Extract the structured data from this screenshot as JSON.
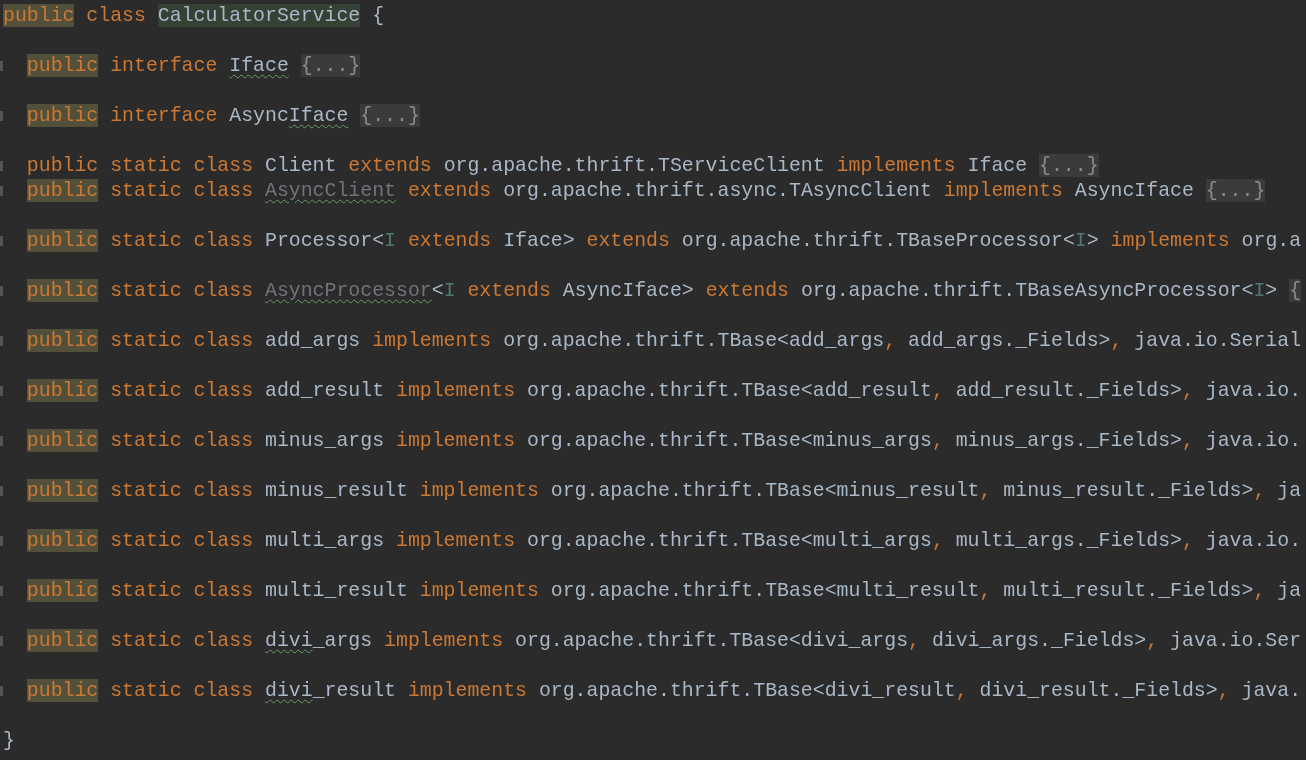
{
  "editor": {
    "lines": [
      {
        "kind": "code",
        "indented": false,
        "fold_marker": false,
        "tokens": [
          {
            "text": "public",
            "kind": "keyword-marked"
          },
          {
            "text": " class ",
            "kind": "keyword"
          },
          {
            "text": "CalculatorService",
            "kind": "name-marked"
          },
          {
            "text": " {",
            "kind": "name"
          }
        ]
      },
      {
        "kind": "blank"
      },
      {
        "kind": "code",
        "indented": true,
        "fold_marker": true,
        "tokens": [
          {
            "text": "public",
            "kind": "keyword-marked"
          },
          {
            "text": " interface ",
            "kind": "keyword"
          },
          {
            "text": "Iface",
            "kind": "name-typo"
          },
          {
            "text": "{...}",
            "kind": "fold"
          }
        ]
      },
      {
        "kind": "blank"
      },
      {
        "kind": "code",
        "indented": true,
        "fold_marker": true,
        "tokens": [
          {
            "text": "public",
            "kind": "keyword-marked"
          },
          {
            "text": " interface ",
            "kind": "keyword"
          },
          {
            "text": "Async",
            "kind": "name"
          },
          {
            "text": "Iface",
            "kind": "name-typo"
          },
          {
            "text": "{...}",
            "kind": "fold"
          }
        ]
      },
      {
        "kind": "blank"
      },
      {
        "kind": "code",
        "indented": true,
        "fold_marker": true,
        "tokens": [
          {
            "text": "public static class ",
            "kind": "keyword"
          },
          {
            "text": "Client",
            "kind": "name"
          },
          {
            "text": " extends ",
            "kind": "keyword"
          },
          {
            "text": "org.apache.thrift.TServiceClient",
            "kind": "name"
          },
          {
            "text": " implements ",
            "kind": "keyword"
          },
          {
            "text": "Iface",
            "kind": "name"
          },
          {
            "text": "{...}",
            "kind": "fold"
          }
        ]
      },
      {
        "kind": "code",
        "indented": true,
        "fold_marker": true,
        "tokens": [
          {
            "text": "public",
            "kind": "keyword-marked"
          },
          {
            "text": " static class ",
            "kind": "keyword"
          },
          {
            "text": "AsyncClient",
            "kind": "unused-typo"
          },
          {
            "text": " extends ",
            "kind": "keyword"
          },
          {
            "text": "org.apache.thrift.async.TAsyncClient",
            "kind": "name"
          },
          {
            "text": " implements ",
            "kind": "keyword"
          },
          {
            "text": "AsyncIface",
            "kind": "name"
          },
          {
            "text": "{...}",
            "kind": "fold"
          }
        ]
      },
      {
        "kind": "blank"
      },
      {
        "kind": "code",
        "indented": true,
        "fold_marker": true,
        "tokens": [
          {
            "text": "public",
            "kind": "keyword-marked"
          },
          {
            "text": " static class ",
            "kind": "keyword"
          },
          {
            "text": "Processor<",
            "kind": "name"
          },
          {
            "text": "I",
            "kind": "param"
          },
          {
            "text": " extends ",
            "kind": "keyword"
          },
          {
            "text": "Iface>",
            "kind": "name"
          },
          {
            "text": " extends ",
            "kind": "keyword"
          },
          {
            "text": "org.apache.thrift.TBaseProcessor<",
            "kind": "name"
          },
          {
            "text": "I",
            "kind": "param"
          },
          {
            "text": ">",
            "kind": "name"
          },
          {
            "text": " implements ",
            "kind": "keyword"
          },
          {
            "text": "org.a",
            "kind": "name"
          }
        ]
      },
      {
        "kind": "blank"
      },
      {
        "kind": "code",
        "indented": true,
        "fold_marker": true,
        "tokens": [
          {
            "text": "public",
            "kind": "keyword-marked"
          },
          {
            "text": " static class ",
            "kind": "keyword"
          },
          {
            "text": "AsyncProcessor",
            "kind": "unused-typo"
          },
          {
            "text": "<",
            "kind": "name"
          },
          {
            "text": "I",
            "kind": "param"
          },
          {
            "text": " extends ",
            "kind": "keyword"
          },
          {
            "text": "AsyncIface>",
            "kind": "name"
          },
          {
            "text": " extends ",
            "kind": "keyword"
          },
          {
            "text": "org.apache.thrift.TBaseAsyncProcessor<",
            "kind": "name"
          },
          {
            "text": "I",
            "kind": "param"
          },
          {
            "text": ">",
            "kind": "name"
          },
          {
            "text": "{",
            "kind": "fold"
          }
        ]
      },
      {
        "kind": "blank"
      },
      {
        "kind": "code",
        "indented": true,
        "fold_marker": true,
        "tokens": [
          {
            "text": "public",
            "kind": "keyword-marked"
          },
          {
            "text": " static class ",
            "kind": "keyword"
          },
          {
            "text": "add_args",
            "kind": "name"
          },
          {
            "text": " implements ",
            "kind": "keyword"
          },
          {
            "text": "org.apache.thrift.TBase<add_args",
            "kind": "name"
          },
          {
            "text": ", ",
            "kind": "keyword"
          },
          {
            "text": "add_args._Fields>",
            "kind": "name"
          },
          {
            "text": ", ",
            "kind": "keyword"
          },
          {
            "text": "java.io.Serial",
            "kind": "name"
          }
        ]
      },
      {
        "kind": "blank"
      },
      {
        "kind": "code",
        "indented": true,
        "fold_marker": true,
        "tokens": [
          {
            "text": "public",
            "kind": "keyword-marked"
          },
          {
            "text": " static class ",
            "kind": "keyword"
          },
          {
            "text": "add_result",
            "kind": "name"
          },
          {
            "text": " implements ",
            "kind": "keyword"
          },
          {
            "text": "org.apache.thrift.TBase<add_result",
            "kind": "name"
          },
          {
            "text": ", ",
            "kind": "keyword"
          },
          {
            "text": "add_result._Fields>",
            "kind": "name"
          },
          {
            "text": ", ",
            "kind": "keyword"
          },
          {
            "text": "java.io.",
            "kind": "name"
          }
        ]
      },
      {
        "kind": "blank"
      },
      {
        "kind": "code",
        "indented": true,
        "fold_marker": true,
        "tokens": [
          {
            "text": "public",
            "kind": "keyword-marked"
          },
          {
            "text": " static class ",
            "kind": "keyword"
          },
          {
            "text": "minus_args",
            "kind": "name"
          },
          {
            "text": " implements ",
            "kind": "keyword"
          },
          {
            "text": "org.apache.thrift.TBase<minus_args",
            "kind": "name"
          },
          {
            "text": ", ",
            "kind": "keyword"
          },
          {
            "text": "minus_args._Fields>",
            "kind": "name"
          },
          {
            "text": ", ",
            "kind": "keyword"
          },
          {
            "text": "java.io.",
            "kind": "name"
          }
        ]
      },
      {
        "kind": "blank"
      },
      {
        "kind": "code",
        "indented": true,
        "fold_marker": true,
        "tokens": [
          {
            "text": "public",
            "kind": "keyword-marked"
          },
          {
            "text": " static class ",
            "kind": "keyword"
          },
          {
            "text": "minus_result",
            "kind": "name"
          },
          {
            "text": " implements ",
            "kind": "keyword"
          },
          {
            "text": "org.apache.thrift.TBase<minus_result",
            "kind": "name"
          },
          {
            "text": ", ",
            "kind": "keyword"
          },
          {
            "text": "minus_result._Fields>",
            "kind": "name"
          },
          {
            "text": ", ",
            "kind": "keyword"
          },
          {
            "text": "ja",
            "kind": "name"
          }
        ]
      },
      {
        "kind": "blank"
      },
      {
        "kind": "code",
        "indented": true,
        "fold_marker": true,
        "tokens": [
          {
            "text": "public",
            "kind": "keyword-marked"
          },
          {
            "text": " static class ",
            "kind": "keyword"
          },
          {
            "text": "multi_args",
            "kind": "name"
          },
          {
            "text": " implements ",
            "kind": "keyword"
          },
          {
            "text": "org.apache.thrift.TBase<multi_args",
            "kind": "name"
          },
          {
            "text": ", ",
            "kind": "keyword"
          },
          {
            "text": "multi_args._Fields>",
            "kind": "name"
          },
          {
            "text": ", ",
            "kind": "keyword"
          },
          {
            "text": "java.io.",
            "kind": "name"
          }
        ]
      },
      {
        "kind": "blank"
      },
      {
        "kind": "code",
        "indented": true,
        "fold_marker": true,
        "tokens": [
          {
            "text": "public",
            "kind": "keyword-marked"
          },
          {
            "text": " static class ",
            "kind": "keyword"
          },
          {
            "text": "multi_result",
            "kind": "name"
          },
          {
            "text": " implements ",
            "kind": "keyword"
          },
          {
            "text": "org.apache.thrift.TBase<multi_result",
            "kind": "name"
          },
          {
            "text": ", ",
            "kind": "keyword"
          },
          {
            "text": "multi_result._Fields>",
            "kind": "name"
          },
          {
            "text": ", ",
            "kind": "keyword"
          },
          {
            "text": "ja",
            "kind": "name"
          }
        ]
      },
      {
        "kind": "blank"
      },
      {
        "kind": "code",
        "indented": true,
        "fold_marker": true,
        "tokens": [
          {
            "text": "public",
            "kind": "keyword-marked"
          },
          {
            "text": " static class ",
            "kind": "keyword"
          },
          {
            "text": "divi",
            "kind": "name-typo"
          },
          {
            "text": "_args",
            "kind": "name"
          },
          {
            "text": " implements ",
            "kind": "keyword"
          },
          {
            "text": "org.apache.thrift.TBase<divi_args",
            "kind": "name"
          },
          {
            "text": ", ",
            "kind": "keyword"
          },
          {
            "text": "divi_args._Fields>",
            "kind": "name"
          },
          {
            "text": ", ",
            "kind": "keyword"
          },
          {
            "text": "java.io.Ser",
            "kind": "name"
          }
        ]
      },
      {
        "kind": "blank"
      },
      {
        "kind": "code",
        "indented": true,
        "fold_marker": true,
        "tokens": [
          {
            "text": "public",
            "kind": "keyword-marked"
          },
          {
            "text": " static class ",
            "kind": "keyword"
          },
          {
            "text": "divi",
            "kind": "name-typo"
          },
          {
            "text": "_result",
            "kind": "name"
          },
          {
            "text": " implements ",
            "kind": "keyword"
          },
          {
            "text": "org.apache.thrift.TBase<divi_result",
            "kind": "name"
          },
          {
            "text": ", ",
            "kind": "keyword"
          },
          {
            "text": "divi_result._Fields>",
            "kind": "name"
          },
          {
            "text": ", ",
            "kind": "keyword"
          },
          {
            "text": "java.",
            "kind": "name"
          }
        ]
      },
      {
        "kind": "blank"
      },
      {
        "kind": "code",
        "indented": false,
        "fold_marker": false,
        "tokens": [
          {
            "text": "}",
            "kind": "name"
          }
        ]
      }
    ]
  }
}
